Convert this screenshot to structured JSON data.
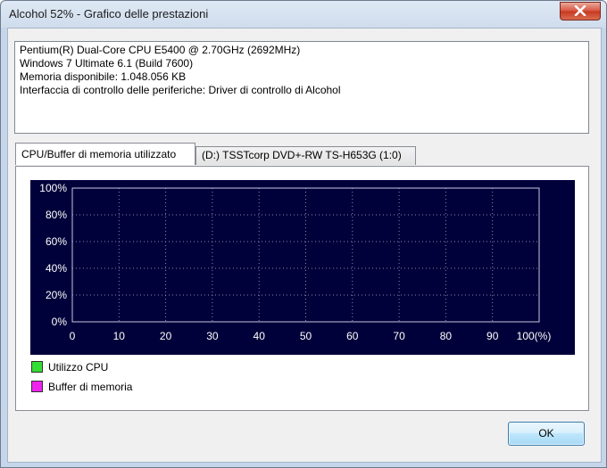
{
  "window": {
    "title": "Alcohol 52% - Grafico delle prestazioni"
  },
  "info": {
    "lines": [
      "Pentium(R) Dual-Core CPU E5400 @ 2.70GHz (2692MHz)",
      "Windows 7 Ultimate 6.1  (Build 7600)",
      "Memoria disponibile: 1.048.056 KB",
      "Interfaccia di controllo delle periferiche: Driver di controllo di Alcohol"
    ]
  },
  "tabs": [
    {
      "label": "CPU/Buffer di memoria utilizzato",
      "active": true
    },
    {
      "label": "(D:) TSSTcorp DVD+-RW TS-H653G (1:0)",
      "active": false
    }
  ],
  "chart_data": {
    "type": "line",
    "title": "",
    "xlabel": "",
    "ylabel": "",
    "x_ticks": [
      "0",
      "10",
      "20",
      "30",
      "40",
      "50",
      "60",
      "70",
      "80",
      "90",
      "100(%)"
    ],
    "y_ticks": [
      "100%",
      "80%",
      "60%",
      "40%",
      "20%",
      "0%"
    ],
    "xlim": [
      0,
      100
    ],
    "ylim": [
      0,
      100
    ],
    "grid": true,
    "series": [
      {
        "name": "Utilizzo CPU",
        "color": "#00ff00",
        "values": []
      },
      {
        "name": "Buffer di memoria",
        "color": "#ff00ff",
        "values": []
      }
    ]
  },
  "legend": {
    "cpu_label": "Utilizzo CPU",
    "buffer_label": "Buffer di memoria",
    "cpu_color": "#33dd33",
    "buffer_color": "#ee22ee"
  },
  "buttons": {
    "ok": "OK"
  },
  "icons": {
    "close": "close-icon"
  }
}
